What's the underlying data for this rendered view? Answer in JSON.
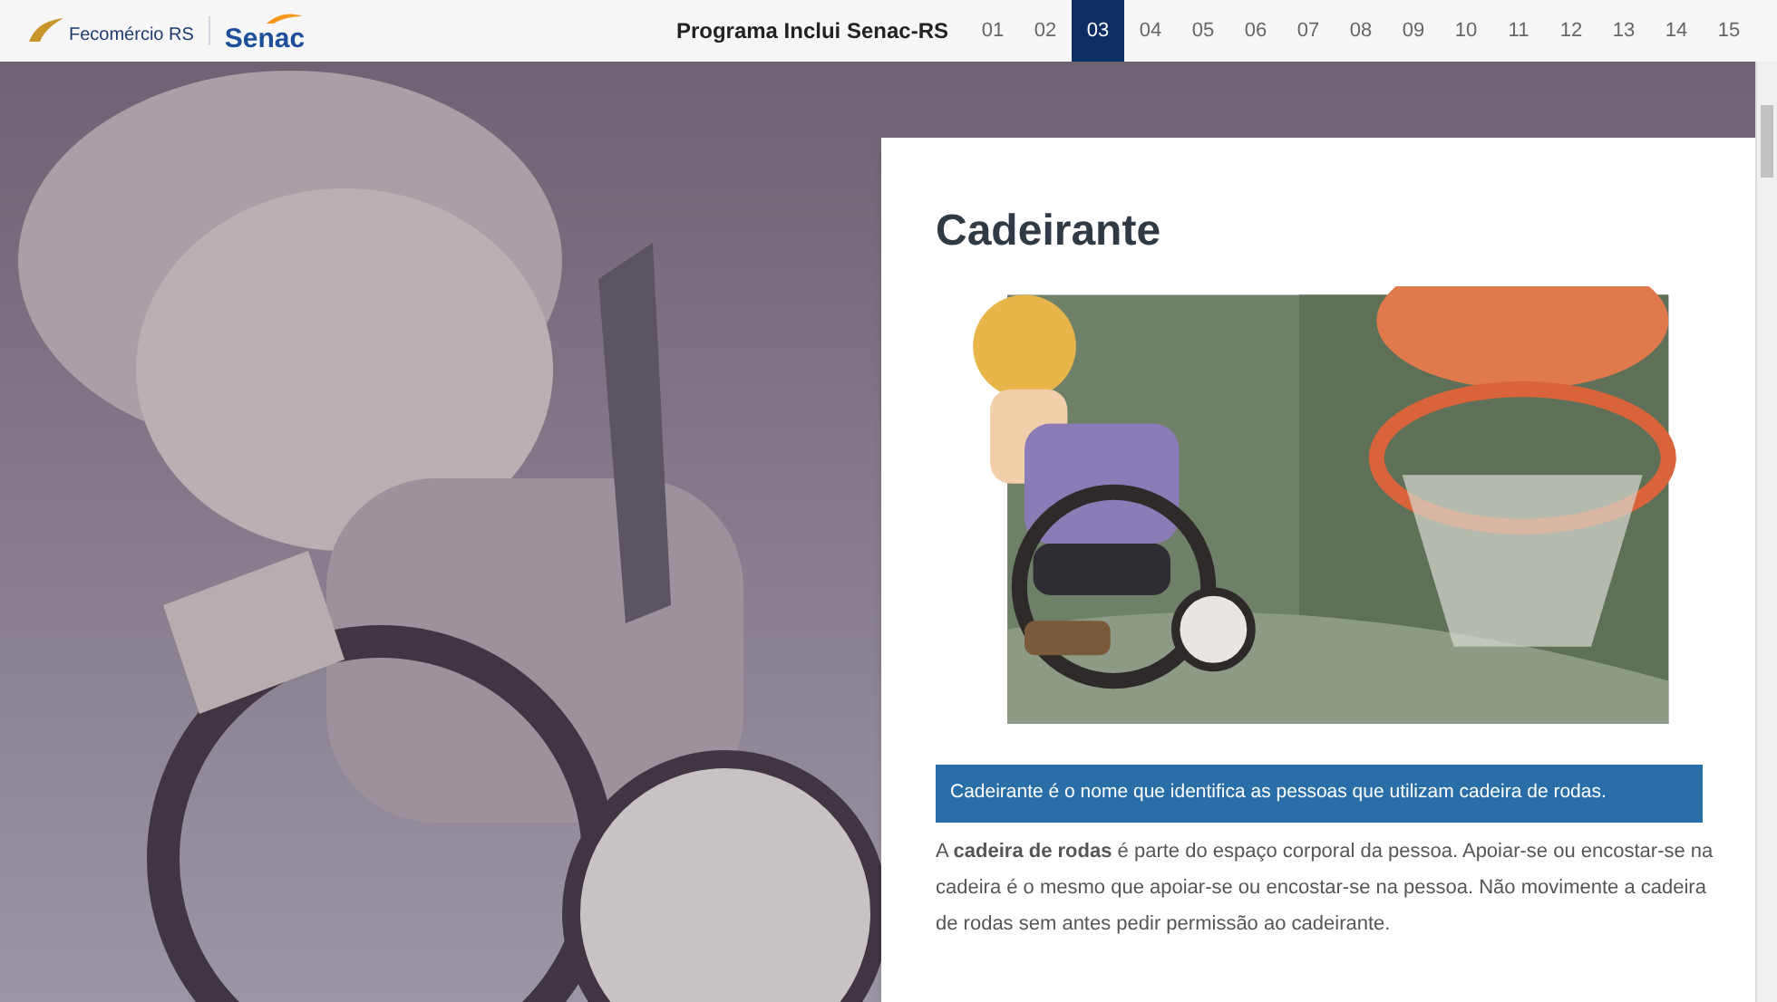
{
  "header": {
    "logos": [
      {
        "kind": "fecomercio",
        "text": "Fecomércio RS"
      },
      {
        "kind": "senac",
        "text": "Senac"
      }
    ],
    "program_title": "Programa Inclui Senac-RS",
    "pages": [
      {
        "label": "01",
        "selected": false
      },
      {
        "label": "02",
        "selected": false
      },
      {
        "label": "03",
        "selected": true
      },
      {
        "label": "04",
        "selected": false
      },
      {
        "label": "05",
        "selected": false
      },
      {
        "label": "06",
        "selected": false
      },
      {
        "label": "07",
        "selected": false
      },
      {
        "label": "08",
        "selected": false
      },
      {
        "label": "09",
        "selected": false
      },
      {
        "label": "10",
        "selected": false
      },
      {
        "label": "11",
        "selected": false
      },
      {
        "label": "12",
        "selected": false
      },
      {
        "label": "13",
        "selected": false
      },
      {
        "label": "14",
        "selected": false
      },
      {
        "label": "15",
        "selected": false
      }
    ]
  },
  "card": {
    "title": "Cadeirante",
    "highlight": "Cadeirante é o nome que identifica as pessoas que utilizam cadeira de rodas.",
    "paragraph": "A **cadeira de rodas** é parte do espaço corporal da pessoa. Apoiar-se ou encostar-se na cadeira é o mesmo que apoiar-se ou encostar-se na pessoa. Não movimente a cadeira de rodas sem antes pedir permissão ao cadeirante."
  }
}
